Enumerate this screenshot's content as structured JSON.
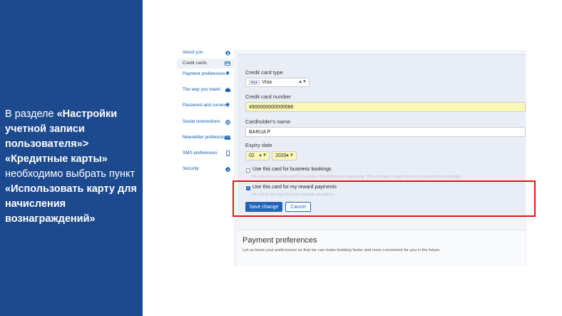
{
  "instruction": {
    "part1": "В разделе ",
    "bold1": "«Настройки учетной записи пользователя»> «Кредитные карты»",
    "part2": " необходимо выбрать пункт ",
    "bold2": "«Использовать карту для начисления вознаграждений»"
  },
  "sidebar": {
    "items": [
      {
        "label": "About you",
        "icon": "person-icon"
      },
      {
        "label": "Credit cards",
        "icon": "card-icon"
      },
      {
        "label": "Payment preferences",
        "icon": "gear-icon"
      },
      {
        "label": "The way you travel",
        "icon": "briefcase-icon"
      },
      {
        "label": "Password and currency",
        "icon": "gear-icon"
      },
      {
        "label": "Social connections",
        "icon": "globe-icon"
      },
      {
        "label": "Newsletter preferences",
        "icon": "envelope-icon"
      },
      {
        "label": "SMS preferences",
        "icon": "phone-icon"
      },
      {
        "label": "Security",
        "icon": "shield-check-icon"
      }
    ]
  },
  "form": {
    "card_type_label": "Credit card type",
    "card_type_badge": "VISA",
    "card_type_value": "Visa",
    "card_number_label": "Credit card number",
    "card_number_value": "4900000000000086",
    "holder_label": "Cardholder's name",
    "holder_value": "BARUA P",
    "expiry_label": "Expiry date",
    "expiry_month": "02",
    "expiry_year": "2020",
    "business_label": "Use this card for business bookings",
    "business_hint": "You can store a credit card for business related travel arrangements. This will make it easier for you to invoice those bookings.",
    "rewards_label": "Use this card for my reward payments",
    "rewards_hint": "This will be the card that your rewards are paid to.",
    "save_label": "Save change",
    "cancel_label": "Cancel"
  },
  "payment_preferences": {
    "title": "Payment preferences",
    "subtitle": "Let us know your preferences so that we can make booking faster and more convenient for you in the future."
  },
  "colors": {
    "panel": "#1d4a8f",
    "accent": "#2565b8",
    "highlight": "#e01616",
    "autofill": "#fbf7b6"
  }
}
